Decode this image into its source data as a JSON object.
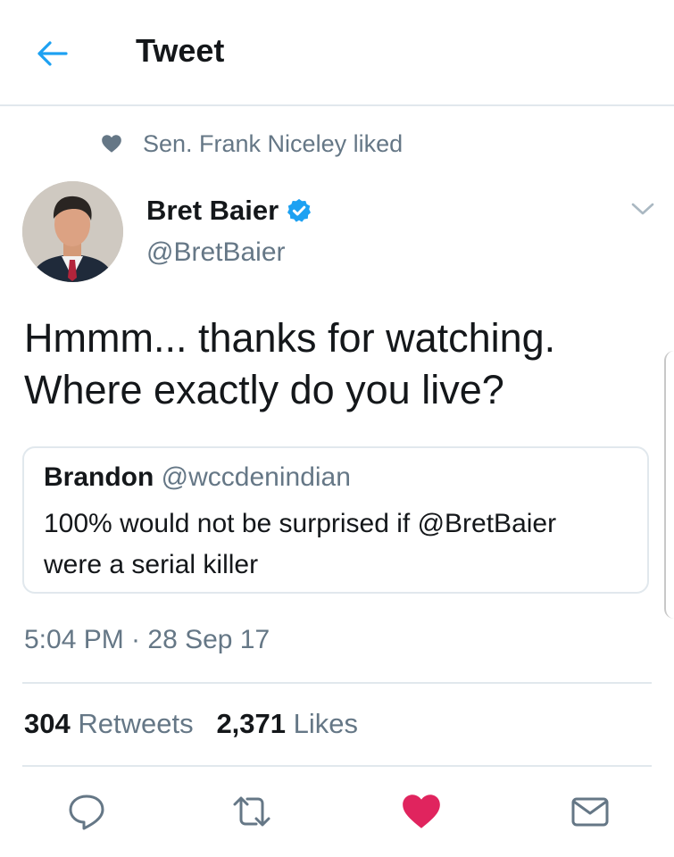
{
  "header": {
    "title": "Tweet",
    "back_icon": "arrow-left-icon",
    "accent": "#1da1f2"
  },
  "social_context": {
    "text": "Sen. Frank Niceley liked",
    "icon": "heart-icon"
  },
  "author": {
    "name": "Bret Baier",
    "handle": "@BretBaier",
    "verified": true,
    "verified_color": "#1da1f2"
  },
  "tweet": {
    "lines": [
      "Hmmm...  thanks for watching.",
      "Where exactly do you live?"
    ]
  },
  "quoted_tweet": {
    "name": "Brandon",
    "handle": "@wccdenindian",
    "lines": [
      "100% would not be surprised if @BretBaier",
      "were a serial killer"
    ]
  },
  "timestamp": "5:04 PM · 28 Sep 17",
  "stats": {
    "retweets_count": "304",
    "retweets_label": "Retweets",
    "likes_count": "2,371",
    "likes_label": "Likes"
  },
  "actions": {
    "reply_icon": "reply-icon",
    "retweet_icon": "retweet-icon",
    "like_icon": "heart-icon",
    "like_color": "#e0245e",
    "share_icon": "envelope-icon"
  }
}
